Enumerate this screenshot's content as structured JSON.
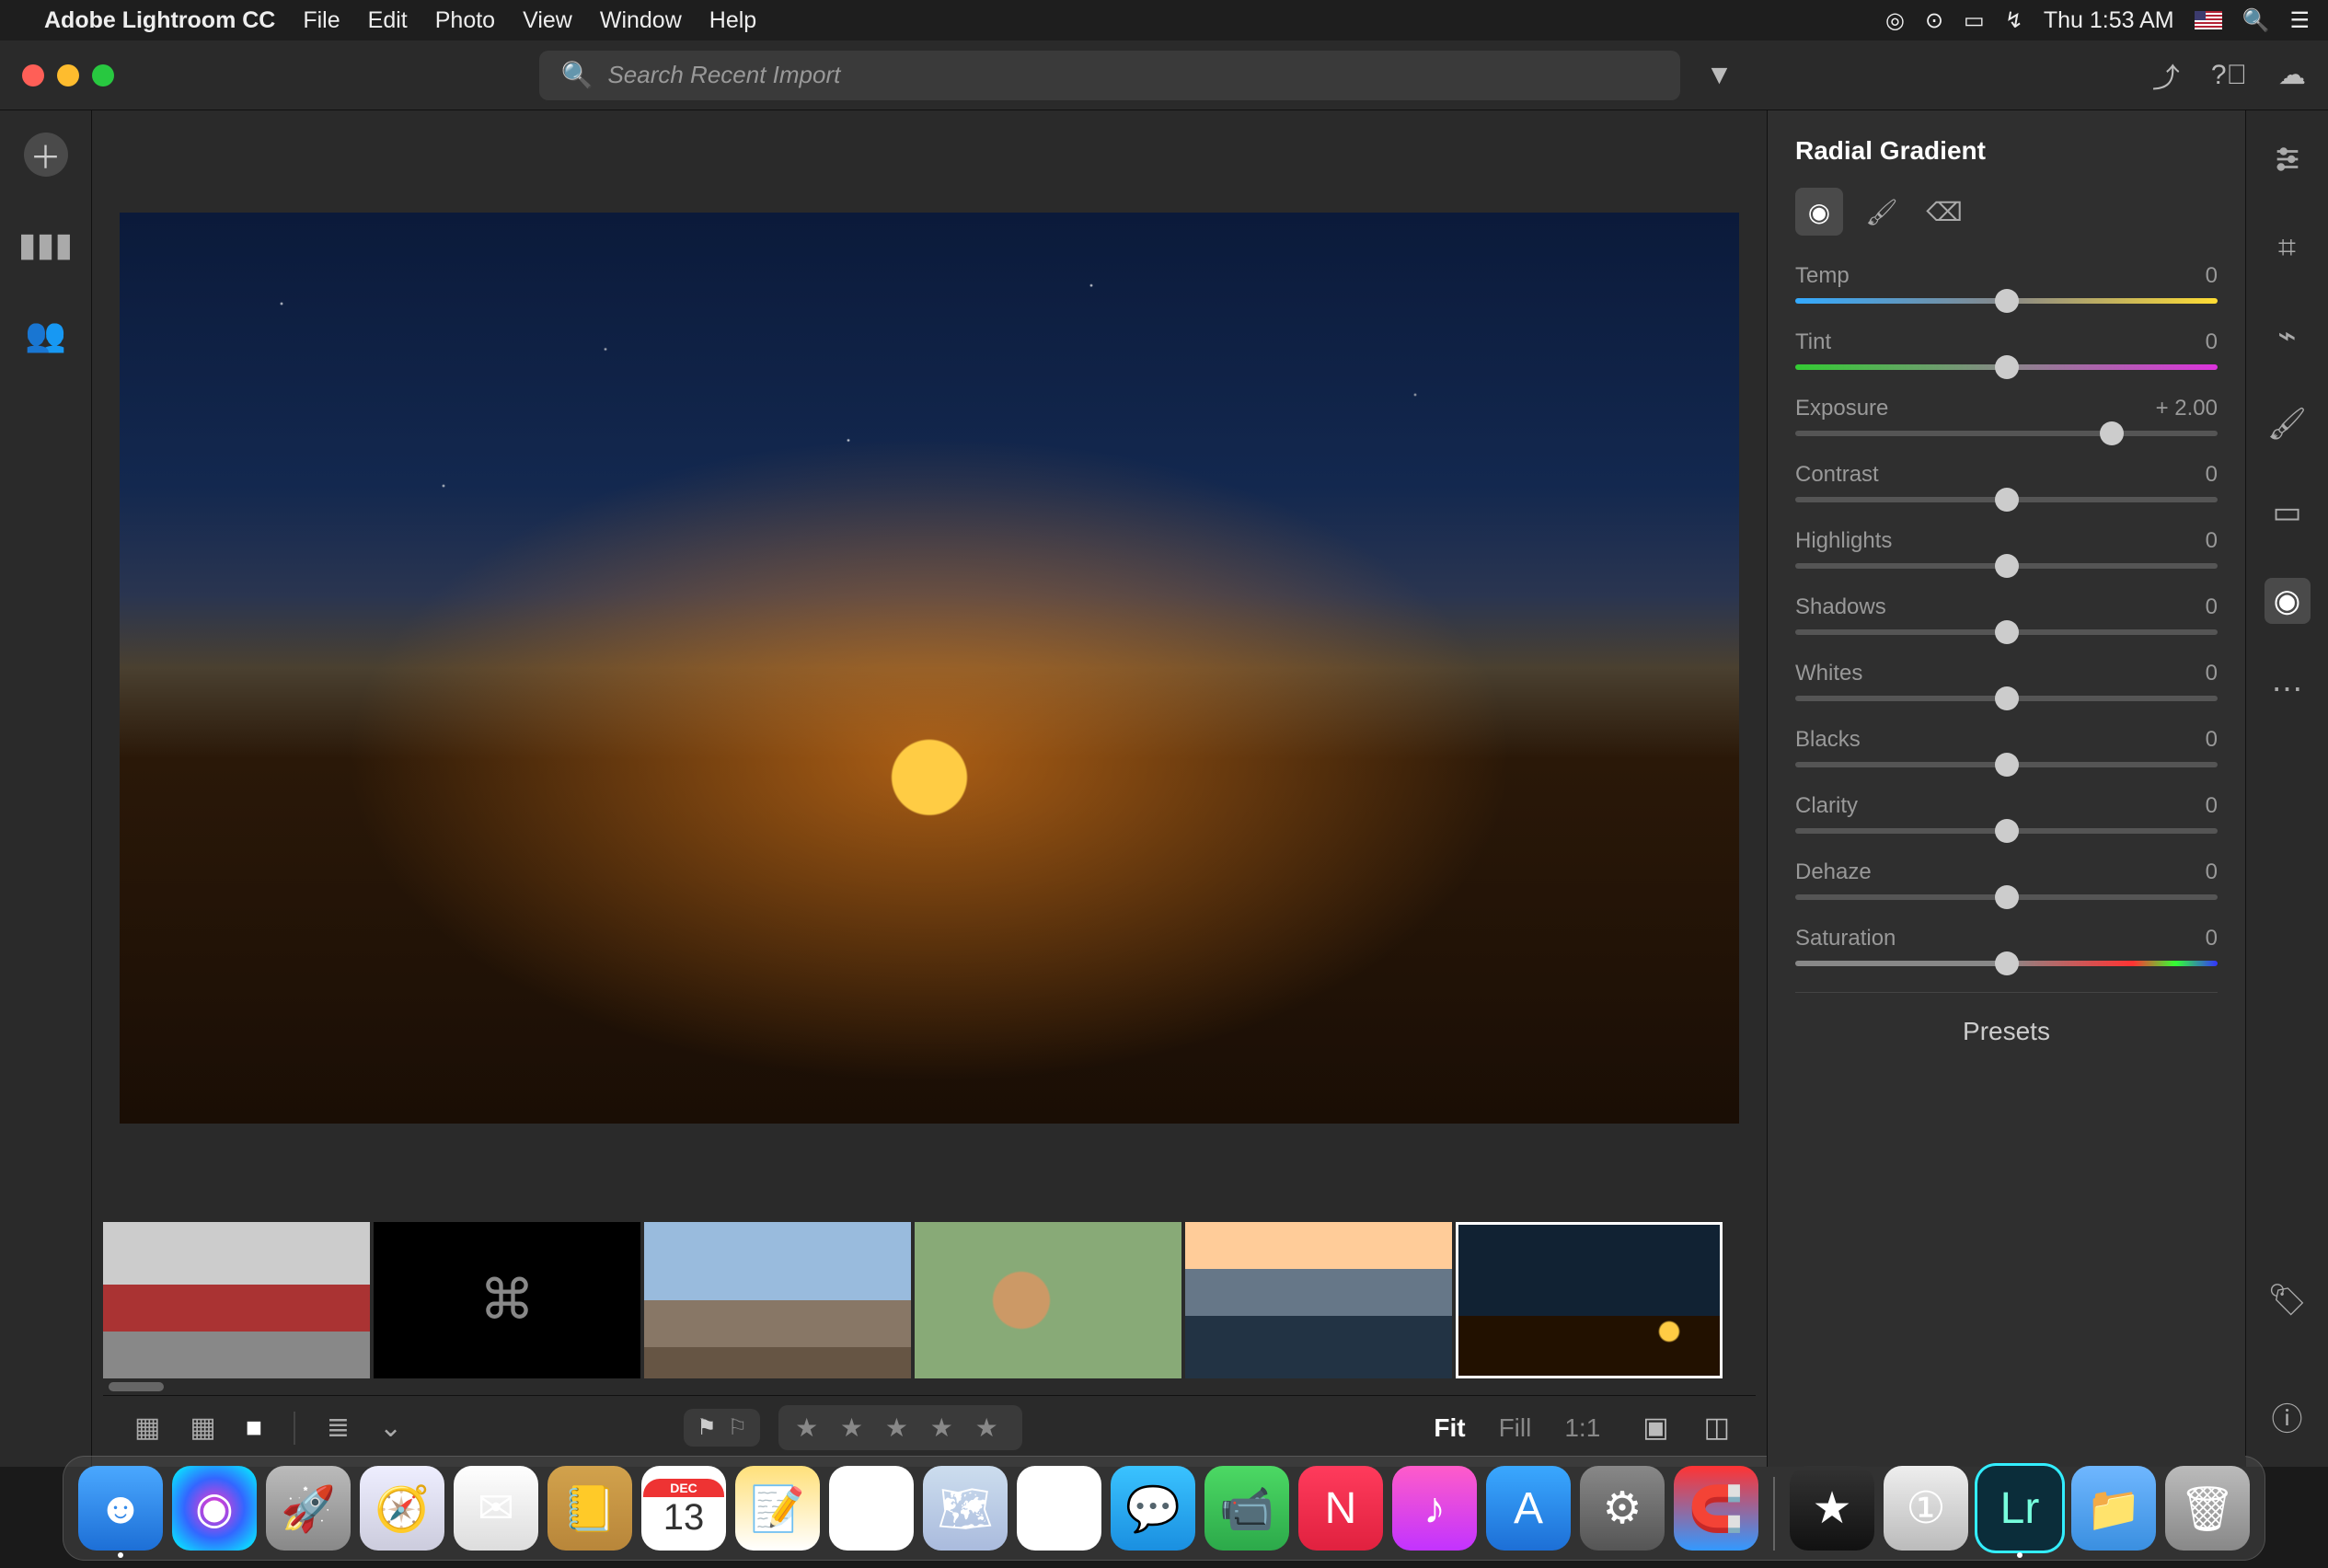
{
  "menubar": {
    "app_name": "Adobe Lightroom CC",
    "items": [
      "File",
      "Edit",
      "Photo",
      "View",
      "Window",
      "Help"
    ],
    "clock": "Thu 1:53 AM"
  },
  "toolbar": {
    "search_placeholder": "Search Recent Import"
  },
  "panel": {
    "title": "Radial Gradient",
    "sliders": [
      {
        "name": "Temp",
        "value": "0",
        "pos": 50,
        "track": "temp"
      },
      {
        "name": "Tint",
        "value": "0",
        "pos": 50,
        "track": "tint"
      },
      {
        "name": "Exposure",
        "value": "+ 2.00",
        "pos": 75,
        "track": "plain"
      },
      {
        "name": "Contrast",
        "value": "0",
        "pos": 50,
        "track": "plain"
      },
      {
        "name": "Highlights",
        "value": "0",
        "pos": 50,
        "track": "plain"
      },
      {
        "name": "Shadows",
        "value": "0",
        "pos": 50,
        "track": "plain"
      },
      {
        "name": "Whites",
        "value": "0",
        "pos": 50,
        "track": "plain"
      },
      {
        "name": "Blacks",
        "value": "0",
        "pos": 50,
        "track": "plain"
      },
      {
        "name": "Clarity",
        "value": "0",
        "pos": 50,
        "track": "plain"
      },
      {
        "name": "Dehaze",
        "value": "0",
        "pos": 50,
        "track": "plain"
      },
      {
        "name": "Saturation",
        "value": "0",
        "pos": 50,
        "track": "sat"
      }
    ],
    "presets_label": "Presets"
  },
  "bottombar": {
    "zoom_fit": "Fit",
    "zoom_fill": "Fill",
    "zoom_11": "1:1",
    "stars": "★ ★ ★ ★ ★"
  },
  "dock_apps": [
    {
      "name": "finder",
      "bg": "linear-gradient(#4aa8ff,#1d6fd6)",
      "glyph": "☻",
      "running": true
    },
    {
      "name": "siri",
      "bg": "radial-gradient(circle,#f3c,#36f,#0ff)",
      "glyph": "◉"
    },
    {
      "name": "launchpad",
      "bg": "linear-gradient(#bbb,#888)",
      "glyph": "🚀"
    },
    {
      "name": "safari",
      "bg": "linear-gradient(#eef,#ccd)",
      "glyph": "🧭"
    },
    {
      "name": "mail",
      "bg": "linear-gradient(#fff,#ddd)",
      "glyph": "✉︎"
    },
    {
      "name": "contacts",
      "bg": "linear-gradient(#d2a24c,#b8863a)",
      "glyph": "📒"
    },
    {
      "name": "calendar",
      "bg": "#fff",
      "glyph": "13"
    },
    {
      "name": "notes",
      "bg": "linear-gradient(#ffe07a,#fff)",
      "glyph": "📝"
    },
    {
      "name": "reminders",
      "bg": "#fff",
      "glyph": "☑︎"
    },
    {
      "name": "maps",
      "bg": "linear-gradient(#cde,#abd)",
      "glyph": "🗺"
    },
    {
      "name": "photos",
      "bg": "#fff",
      "glyph": "❀"
    },
    {
      "name": "messages",
      "bg": "linear-gradient(#3ac3ff,#1a8fe0)",
      "glyph": "💬"
    },
    {
      "name": "facetime",
      "bg": "linear-gradient(#4cd964,#2ca94a)",
      "glyph": "📹"
    },
    {
      "name": "news",
      "bg": "linear-gradient(#ff3b5c,#e0213f)",
      "glyph": "N"
    },
    {
      "name": "itunes",
      "bg": "linear-gradient(#ff5cc9,#c233ff)",
      "glyph": "♪"
    },
    {
      "name": "appstore",
      "bg": "linear-gradient(#3aa8ff,#1d6fd6)",
      "glyph": "A"
    },
    {
      "name": "preferences",
      "bg": "linear-gradient(#888,#555)",
      "glyph": "⚙︎"
    },
    {
      "name": "magnet",
      "bg": "linear-gradient(#f33,#39f)",
      "glyph": "🧲"
    }
  ],
  "dock_right": [
    {
      "name": "imovie",
      "bg": "linear-gradient(#333,#111)",
      "glyph": "★"
    },
    {
      "name": "1password",
      "bg": "linear-gradient(#eee,#bbb)",
      "glyph": "①"
    },
    {
      "name": "lightroom",
      "bg": "#0b2d3a",
      "glyph": "Lr",
      "running": true,
      "active": true
    },
    {
      "name": "downloads",
      "bg": "linear-gradient(#6fb7ff,#3a8fe0)",
      "glyph": "📁"
    },
    {
      "name": "trash",
      "bg": "linear-gradient(#bbb,#888)",
      "glyph": "🗑"
    }
  ]
}
